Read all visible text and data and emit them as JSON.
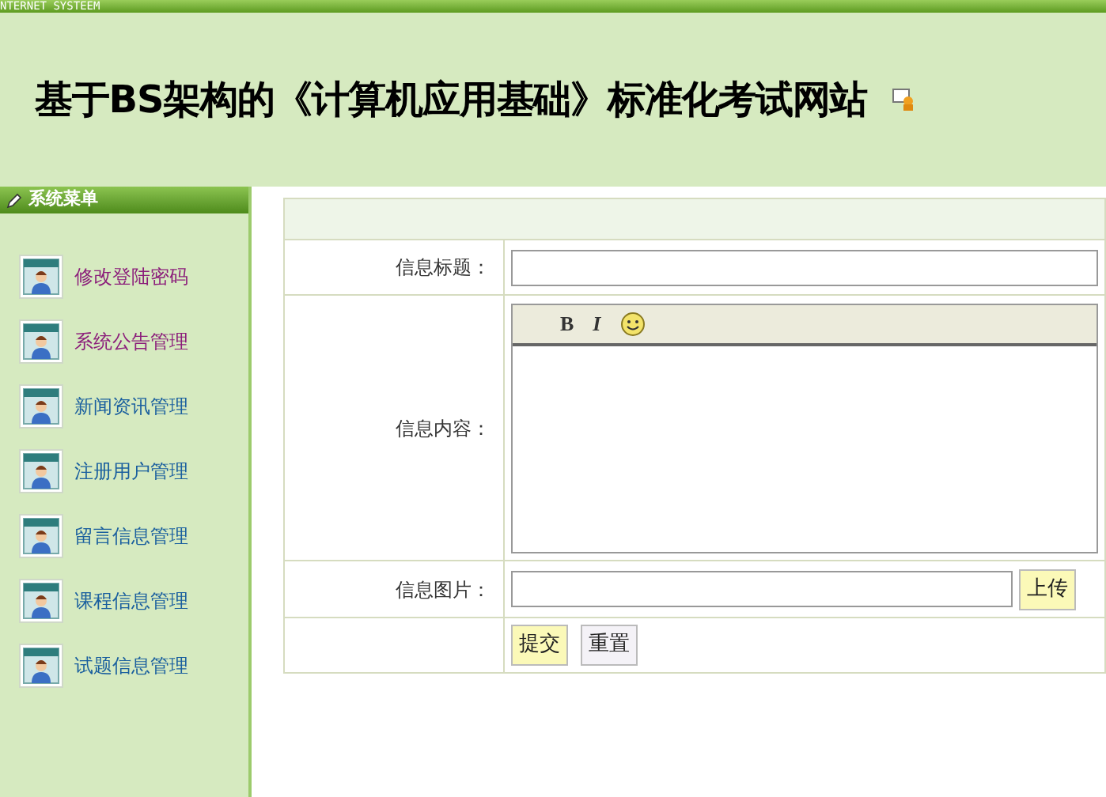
{
  "top_bar": {
    "text": "NTERNET SYSTEEM"
  },
  "header": {
    "title": "基于BS架构的《计算机应用基础》标准化考试网站"
  },
  "sidebar": {
    "title": "系统菜单",
    "items": [
      {
        "label": "修改登陆密码",
        "visited": true
      },
      {
        "label": "系统公告管理",
        "visited": true
      },
      {
        "label": "新闻资讯管理",
        "visited": false
      },
      {
        "label": "注册用户管理",
        "visited": false
      },
      {
        "label": "留言信息管理",
        "visited": false
      },
      {
        "label": "课程信息管理",
        "visited": false
      },
      {
        "label": "试题信息管理",
        "visited": false
      }
    ]
  },
  "form": {
    "fields": [
      {
        "kind": "text",
        "label": "信息标题："
      },
      {
        "kind": "editor",
        "label": "信息内容：",
        "tools": [
          "B",
          "I"
        ]
      },
      {
        "kind": "upload",
        "label": "信息图片：",
        "button": "上传"
      }
    ],
    "buttons": [
      {
        "label": "提交",
        "primary": true
      },
      {
        "label": "重置",
        "primary": false
      }
    ]
  }
}
